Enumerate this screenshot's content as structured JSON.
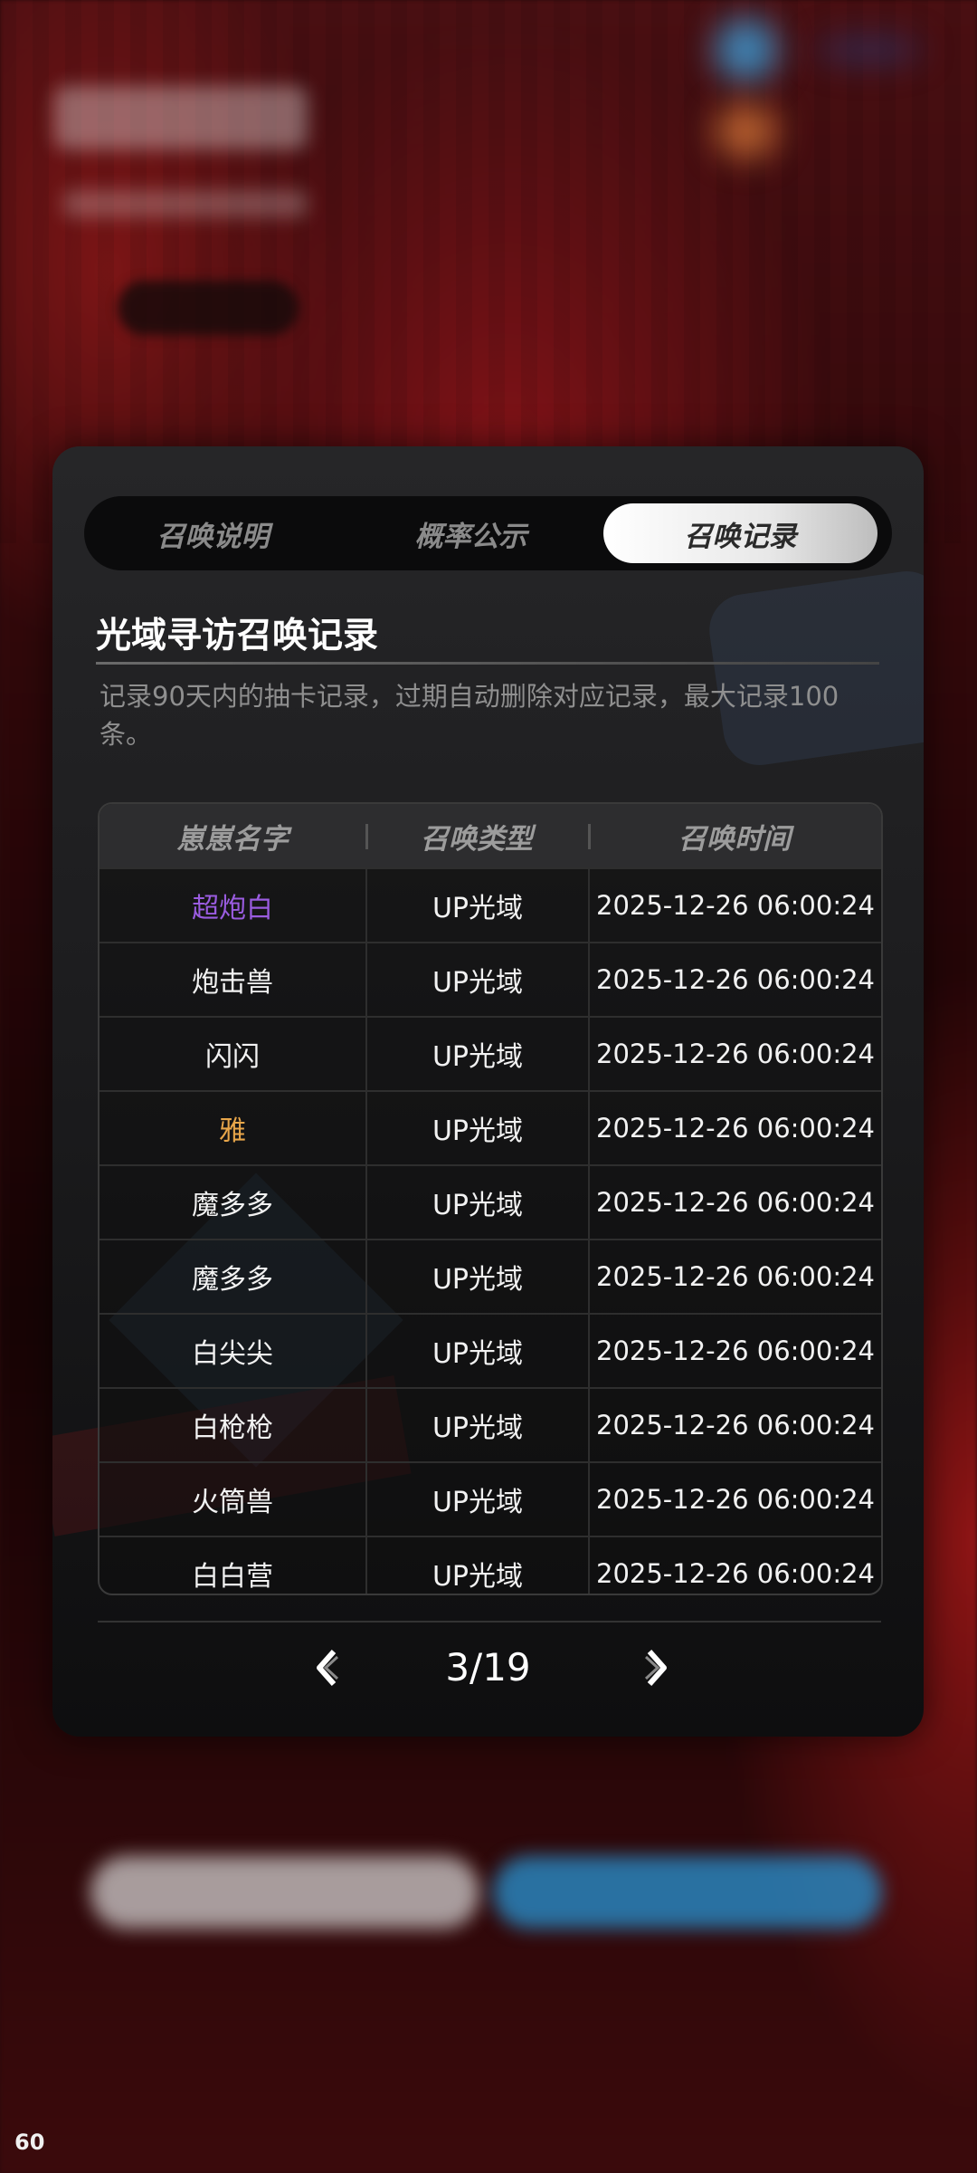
{
  "tabs": [
    {
      "label": "召唤说明",
      "active": false
    },
    {
      "label": "概率公示",
      "active": false
    },
    {
      "label": "召唤记录",
      "active": true
    }
  ],
  "title": "光域寻访召唤记录",
  "description": "记录90天内的抽卡记录，过期自动删除对应记录，最大记录100条。",
  "table": {
    "headers": [
      "崽崽名字",
      "召唤类型",
      "召唤时间"
    ],
    "rows": [
      {
        "name": "超炮白",
        "name_color": "#9a5ce0",
        "type": "UP光域",
        "time": "2025-12-26 06:00:24"
      },
      {
        "name": "炮击兽",
        "name_color": "#f2f2f2",
        "type": "UP光域",
        "time": "2025-12-26 06:00:24"
      },
      {
        "name": "闪闪",
        "name_color": "#f2f2f2",
        "type": "UP光域",
        "time": "2025-12-26 06:00:24"
      },
      {
        "name": "雅",
        "name_color": "#e8a64a",
        "type": "UP光域",
        "time": "2025-12-26 06:00:24"
      },
      {
        "name": "魔多多",
        "name_color": "#f2f2f2",
        "type": "UP光域",
        "time": "2025-12-26 06:00:24"
      },
      {
        "name": "魔多多",
        "name_color": "#f2f2f2",
        "type": "UP光域",
        "time": "2025-12-26 06:00:24"
      },
      {
        "name": "白尖尖",
        "name_color": "#f2f2f2",
        "type": "UP光域",
        "time": "2025-12-26 06:00:24"
      },
      {
        "name": "白枪枪",
        "name_color": "#f2f2f2",
        "type": "UP光域",
        "time": "2025-12-26 06:00:24"
      },
      {
        "name": "火筒兽",
        "name_color": "#f2f2f2",
        "type": "UP光域",
        "time": "2025-12-26 06:00:24"
      },
      {
        "name": "白白营",
        "name_color": "#f2f2f2",
        "type": "UP光域",
        "time": "2025-12-26 06:00:24"
      }
    ]
  },
  "pager": {
    "text": "3/19",
    "prev_icon": "chevron-left-icon",
    "next_icon": "chevron-right-icon"
  },
  "fps": "60"
}
